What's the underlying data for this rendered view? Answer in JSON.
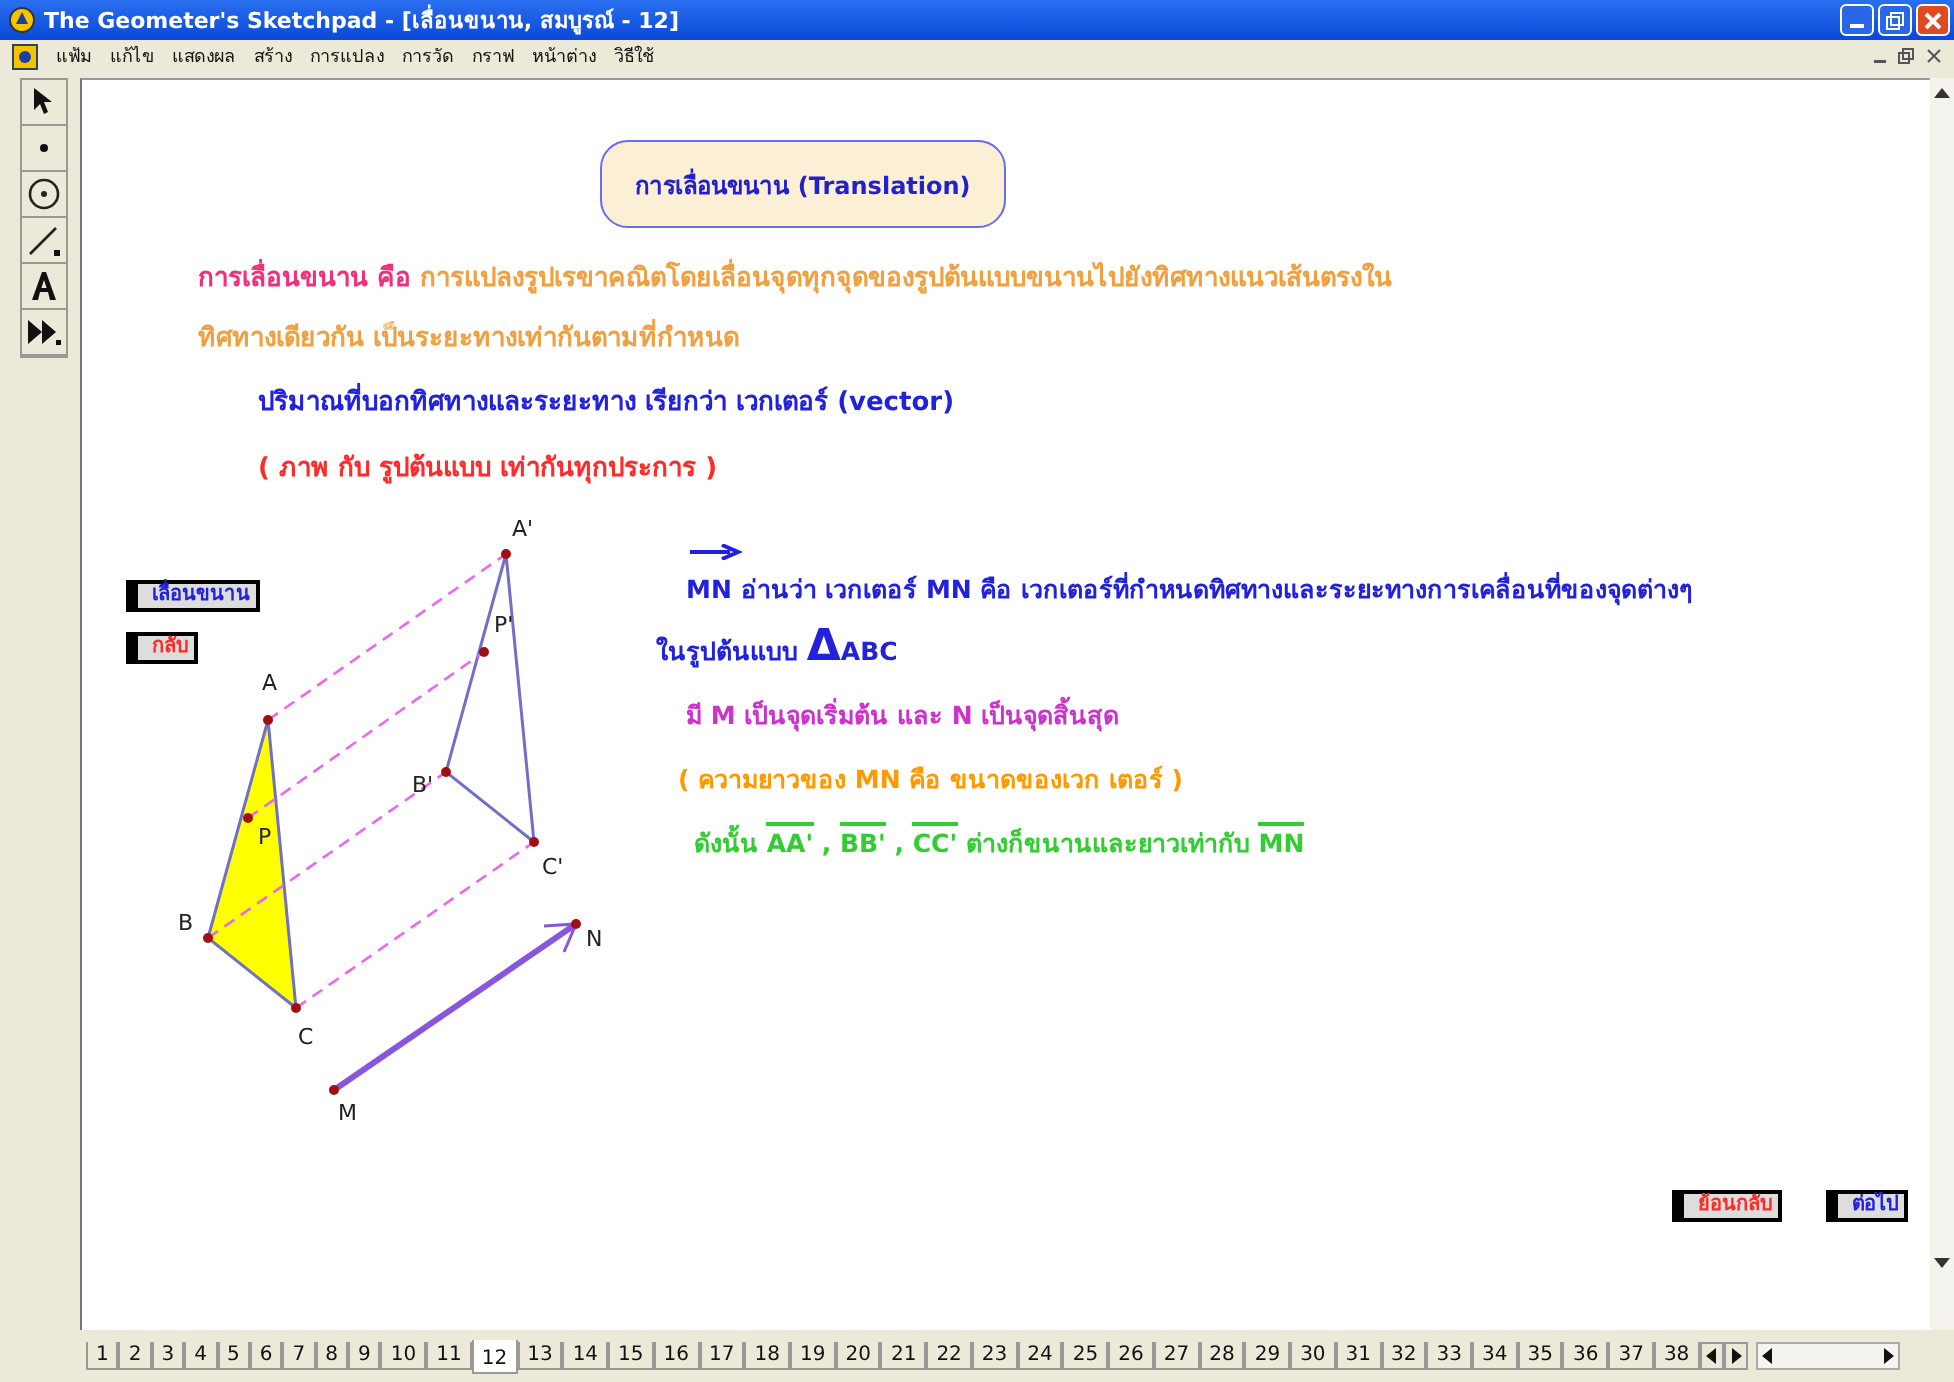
{
  "window": {
    "title": "The Geometer's Sketchpad - [เลื่อนขนาน, สมบูรณ์ - 12]"
  },
  "menu": [
    "แฟ้ม",
    "แก้ไข",
    "แสดงผล",
    "สร้าง",
    "การแปลง",
    "การวัด",
    "กราฟ",
    "หน้าต่าง",
    "วิธีใช้"
  ],
  "heading": "การเลื่อนขนาน (Translation)",
  "left_text": [
    {
      "segments": [
        {
          "text": "การเลื่อนขนาน  คือ",
          "color": "#f0307a"
        },
        {
          "text": " การแปลงรูปเรขาคณิตโดยเลื่อนจุดทุกจุดของรูปต้นแบบขนานไปยังทิศทางแนวเส้นตรงใน",
          "color": "#f0a040"
        }
      ]
    },
    {
      "segments": [
        {
          "text": "ทิศทางเดียวกัน  เป็นระยะทางเท่ากันตามที่กำหนด",
          "color": "#f0a040"
        }
      ]
    },
    {
      "segments": [
        {
          "text": "ปริมาณที่บอกทิศทางและระยะทาง   เรียกว่า  เวกเตอร์ (vector)",
          "color": "#2222dd"
        }
      ]
    },
    {
      "segments": [
        {
          "text": "( ภาพ กับ รูปต้นแบบ  เท่ากันทุกประการ )",
          "color": "#ff2a2a"
        }
      ]
    }
  ],
  "right_text": [
    {
      "segments": [
        {
          "text": "MN",
          "color": "#2222dd",
          "overline": false
        },
        {
          "text": "  อ่านว่า เวกเตอร์ MN  คือ เวกเตอร์ที่กำหนดทิศทางและระยะทางการเคลื่อนที่ของจุดต่างๆ",
          "color": "#2222dd",
          "overline": false
        }
      ]
    },
    {
      "segments": [
        {
          "text": "ในรูปต้นแบบ ",
          "color": "#2222dd",
          "overline": false
        },
        {
          "text": "Δ",
          "color": "#2222dd",
          "overline": false
        },
        {
          "text": "ABC",
          "color": "#2222dd",
          "overline": false
        }
      ]
    },
    {
      "segments": [
        {
          "text": "มี M เป็นจุดเริ่มต้น  และ  N เป็นจุดสิ้นสุด",
          "color": "#cc33cc",
          "overline": false
        }
      ]
    },
    {
      "segments": [
        {
          "text": "( ความยาวของ ",
          "color": "#ff9900",
          "overline": false
        },
        {
          "text": "MN",
          "color": "#ff9900",
          "overline": false
        },
        {
          "text": " คือ ขนาดของเวก เตอร์ )",
          "color": "#ff9900",
          "overline": false
        }
      ]
    },
    {
      "segments": [
        {
          "text": "ดังนั้น ",
          "color": "#33cc33",
          "overline": false
        },
        {
          "text": "AA'",
          "color": "#33cc33",
          "overline": true
        },
        {
          "text": " , ",
          "color": "#33cc33",
          "overline": false
        },
        {
          "text": "BB'",
          "color": "#33cc33",
          "overline": true
        },
        {
          "text": " , ",
          "color": "#33cc33",
          "overline": false
        },
        {
          "text": "CC'",
          "color": "#33cc33",
          "overline": true
        },
        {
          "text": " ต่างก็ขนานและยาวเท่ากับ ",
          "color": "#33cc33",
          "overline": false
        },
        {
          "text": "MN",
          "color": "#33cc33",
          "overline": true
        }
      ]
    }
  ],
  "action_buttons": [
    {
      "label": "เลื่อนขนาน",
      "color": "#2222dd"
    },
    {
      "label": "กลับ",
      "color": "#ff2a2a"
    },
    {
      "label": "ย้อนกลับ",
      "color": "#ff2a2a"
    },
    {
      "label": "ต่อไป",
      "color": "#2222dd"
    }
  ],
  "point_labels": [
    "A",
    "P",
    "B",
    "C",
    "A'",
    "P'",
    "B'",
    "C'",
    "M",
    "N"
  ],
  "pages": [
    {
      "label": "1",
      "selected": false
    },
    {
      "label": "2",
      "selected": false
    },
    {
      "label": "3",
      "selected": false
    },
    {
      "label": "4",
      "selected": false
    },
    {
      "label": "5",
      "selected": false
    },
    {
      "label": "6",
      "selected": false
    },
    {
      "label": "7",
      "selected": false
    },
    {
      "label": "8",
      "selected": false
    },
    {
      "label": "9",
      "selected": false
    },
    {
      "label": "10",
      "selected": false
    },
    {
      "label": "11",
      "selected": false
    },
    {
      "label": "12",
      "selected": true
    },
    {
      "label": "13",
      "selected": false
    },
    {
      "label": "14",
      "selected": false
    },
    {
      "label": "15",
      "selected": false
    },
    {
      "label": "16",
      "selected": false
    },
    {
      "label": "17",
      "selected": false
    },
    {
      "label": "18",
      "selected": false
    },
    {
      "label": "19",
      "selected": false
    },
    {
      "label": "20",
      "selected": false
    },
    {
      "label": "21",
      "selected": false
    },
    {
      "label": "22",
      "selected": false
    },
    {
      "label": "23",
      "selected": false
    },
    {
      "label": "24",
      "selected": false
    },
    {
      "label": "25",
      "selected": false
    },
    {
      "label": "26",
      "selected": false
    },
    {
      "label": "27",
      "selected": false
    },
    {
      "label": "28",
      "selected": false
    },
    {
      "label": "29",
      "selected": false
    },
    {
      "label": "30",
      "selected": false
    },
    {
      "label": "31",
      "selected": false
    },
    {
      "label": "32",
      "selected": false
    },
    {
      "label": "33",
      "selected": false
    },
    {
      "label": "34",
      "selected": false
    },
    {
      "label": "35",
      "selected": false
    },
    {
      "label": "36",
      "selected": false
    },
    {
      "label": "37",
      "selected": false
    },
    {
      "label": "38",
      "selected": false
    }
  ]
}
